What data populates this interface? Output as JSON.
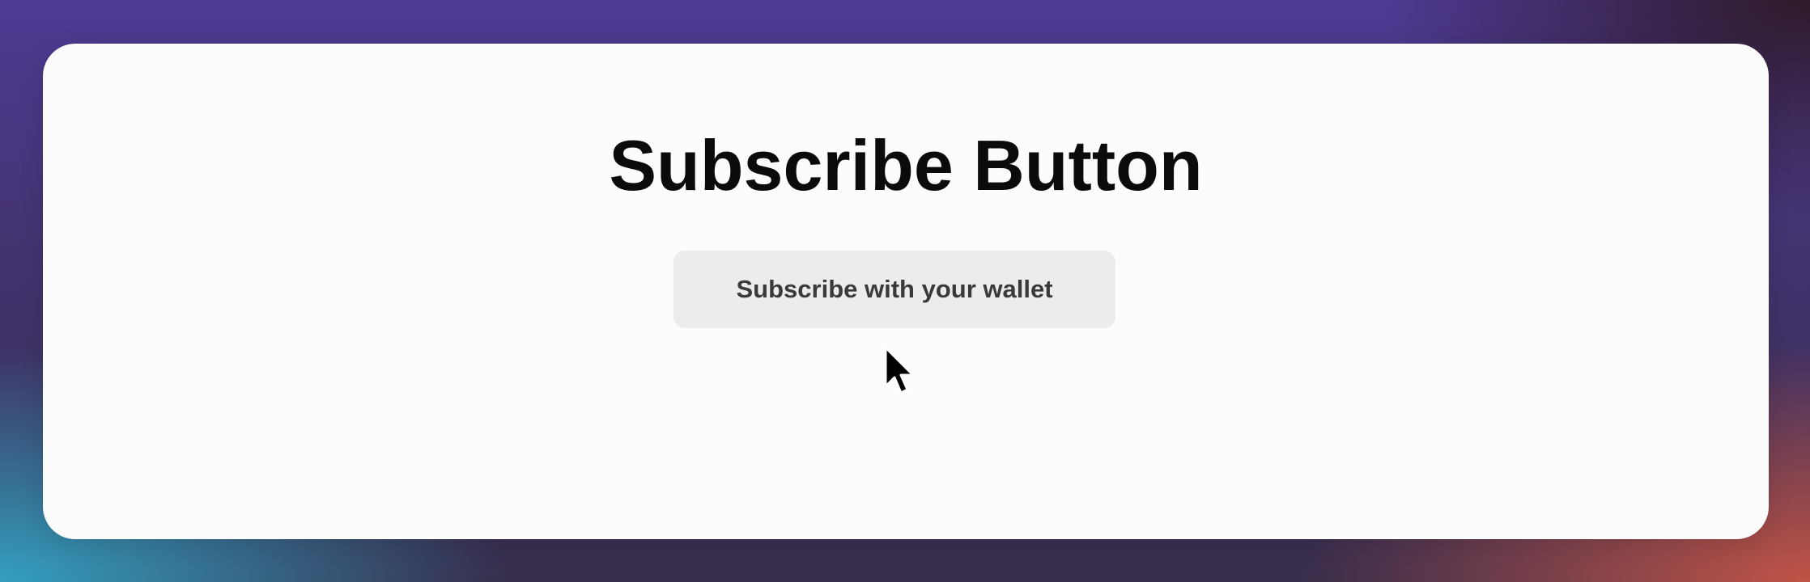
{
  "page": {
    "title": "Subscribe Button"
  },
  "subscribe": {
    "button_label": "Subscribe with your wallet"
  },
  "pointer": {
    "icon": "arrow-cursor-icon"
  },
  "colors": {
    "card_background": "#fcfcfd",
    "button_background": "#ececee",
    "title_text": "#0b0b0b",
    "button_text": "#3a3a3a"
  }
}
